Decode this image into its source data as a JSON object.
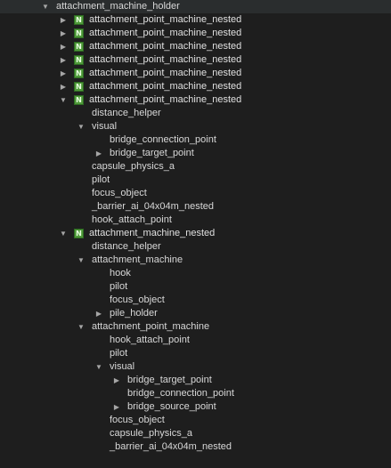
{
  "tree": {
    "nodes": [
      {
        "label": "attachment_machine_holder",
        "depth": 0,
        "expander": "expanded",
        "nested": false
      },
      {
        "label": "attachment_point_machine_nested",
        "depth": 1,
        "expander": "collapsed",
        "nested": true
      },
      {
        "label": "attachment_point_machine_nested",
        "depth": 1,
        "expander": "collapsed",
        "nested": true
      },
      {
        "label": "attachment_point_machine_nested",
        "depth": 1,
        "expander": "collapsed",
        "nested": true
      },
      {
        "label": "attachment_point_machine_nested",
        "depth": 1,
        "expander": "collapsed",
        "nested": true
      },
      {
        "label": "attachment_point_machine_nested",
        "depth": 1,
        "expander": "collapsed",
        "nested": true
      },
      {
        "label": "attachment_point_machine_nested",
        "depth": 1,
        "expander": "collapsed",
        "nested": true
      },
      {
        "label": "attachment_point_machine_nested",
        "depth": 1,
        "expander": "expanded",
        "nested": true
      },
      {
        "label": "distance_helper",
        "depth": 2,
        "expander": "none",
        "nested": false
      },
      {
        "label": "visual",
        "depth": 2,
        "expander": "expanded",
        "nested": false
      },
      {
        "label": "bridge_connection_point",
        "depth": 3,
        "expander": "none",
        "nested": false
      },
      {
        "label": "bridge_target_point",
        "depth": 3,
        "expander": "collapsed",
        "nested": false
      },
      {
        "label": "capsule_physics_a",
        "depth": 2,
        "expander": "none",
        "nested": false
      },
      {
        "label": "pilot",
        "depth": 2,
        "expander": "none",
        "nested": false
      },
      {
        "label": "focus_object",
        "depth": 2,
        "expander": "none",
        "nested": false
      },
      {
        "label": "_barrier_ai_04x04m_nested",
        "depth": 2,
        "expander": "none",
        "nested": false
      },
      {
        "label": "hook_attach_point",
        "depth": 2,
        "expander": "none",
        "nested": false
      },
      {
        "label": "attachment_machine_nested",
        "depth": 1,
        "expander": "expanded",
        "nested": true
      },
      {
        "label": "distance_helper",
        "depth": 2,
        "expander": "none",
        "nested": false
      },
      {
        "label": "attachment_machine",
        "depth": 2,
        "expander": "expanded",
        "nested": false
      },
      {
        "label": "hook",
        "depth": 3,
        "expander": "none",
        "nested": false
      },
      {
        "label": "pilot",
        "depth": 3,
        "expander": "none",
        "nested": false
      },
      {
        "label": "focus_object",
        "depth": 3,
        "expander": "none",
        "nested": false
      },
      {
        "label": "pile_holder",
        "depth": 3,
        "expander": "collapsed",
        "nested": false
      },
      {
        "label": "attachment_point_machine",
        "depth": 2,
        "expander": "expanded",
        "nested": false
      },
      {
        "label": "hook_attach_point",
        "depth": 3,
        "expander": "none",
        "nested": false
      },
      {
        "label": "pilot",
        "depth": 3,
        "expander": "none",
        "nested": false
      },
      {
        "label": "visual",
        "depth": 3,
        "expander": "expanded",
        "nested": false
      },
      {
        "label": "bridge_target_point",
        "depth": 4,
        "expander": "collapsed",
        "nested": false
      },
      {
        "label": "bridge_connection_point",
        "depth": 4,
        "expander": "none",
        "nested": false
      },
      {
        "label": "bridge_source_point",
        "depth": 4,
        "expander": "collapsed",
        "nested": false
      },
      {
        "label": "focus_object",
        "depth": 3,
        "expander": "none",
        "nested": false
      },
      {
        "label": "capsule_physics_a",
        "depth": 3,
        "expander": "none",
        "nested": false
      },
      {
        "label": "_barrier_ai_04x04m_nested",
        "depth": 3,
        "expander": "none",
        "nested": false
      }
    ],
    "nested_badge": "N",
    "expanded_glyph": "▼",
    "collapsed_glyph": "▶"
  }
}
